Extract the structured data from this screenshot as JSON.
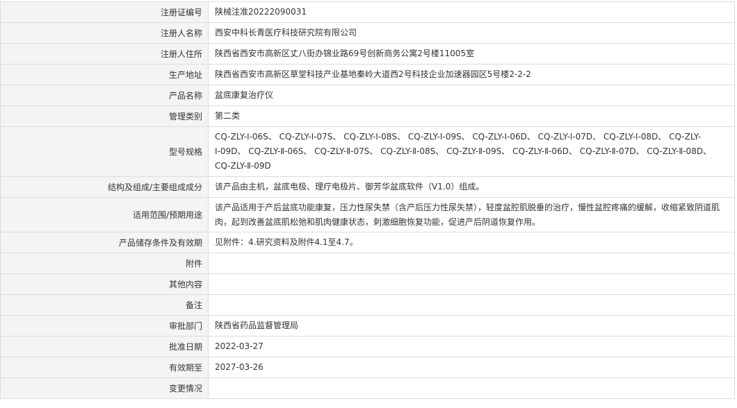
{
  "rows": [
    {
      "label": "注册证编号",
      "value": "陕械注准20222090031"
    },
    {
      "label": "注册人名称",
      "value": "西安中科长青医疗科技研究院有限公司"
    },
    {
      "label": "注册人住所",
      "value": "陕西省西安市高新区丈八街办锦业路69号创新商务公寓2号楼11005室"
    },
    {
      "label": "生产地址",
      "value": "陕西省西安市高新区草堂科技产业基地秦岭大道西2号科技企业加速器园区5号楼2-2-2"
    },
    {
      "label": "产品名称",
      "value": "盆底康复治疗仪"
    },
    {
      "label": "管理类别",
      "value": "第二类"
    },
    {
      "label": "型号规格",
      "value": "CQ-ZLY-Ⅰ-06S、 CQ-ZLY-Ⅰ-07S、 CQ-ZLY-Ⅰ-08S、 CQ-ZLY-Ⅰ-09S、 CQ-ZLY-Ⅰ-06D、 CQ-ZLY-Ⅰ-07D、 CQ-ZLY-Ⅰ-08D、 CQ-ZLY-Ⅰ-09D、 CQ-ZLY-Ⅱ-06S、 CQ-ZLY-Ⅱ-07S、 CQ-ZLY-Ⅱ-08S、 CQ-ZLY-Ⅱ-09S、 CQ-ZLY-Ⅱ-06D、 CQ-ZLY-Ⅱ-07D、 CQ-ZLY-Ⅱ-08D、 CQ-ZLY-Ⅱ-09D"
    },
    {
      "label": "结构及组成/主要组成成分",
      "value": "该产品由主机，盆底电极、理疗电极片、御芳华盆底软件（V1.0）组成。"
    },
    {
      "label": "适用范围/预期用途",
      "value": "该产品适用于产后盆底功能康复，压力性尿失禁（含产后压力性尿失禁），轻度盆腔肌脱垂的治疗，慢性盆腔疼痛的缓解，收缩紧致阴道肌肉，起到改善盆底肌松弛和肌肉健康状态，刺激细胞恢复功能，促进产后阴道恢复作用。"
    },
    {
      "label": "产品储存条件及有效期",
      "value": "见附件：4.研究资料及附件4.1至4.7。"
    },
    {
      "label": "附件",
      "value": ""
    },
    {
      "label": "其他内容",
      "value": ""
    },
    {
      "label": "备注",
      "value": ""
    },
    {
      "label": "审批部门",
      "value": "陕西省药品监督管理局"
    },
    {
      "label": "批准日期",
      "value": "2022-03-27"
    },
    {
      "label": "有效期至",
      "value": "2027-03-26"
    },
    {
      "label": "变更情况",
      "value": ""
    }
  ]
}
